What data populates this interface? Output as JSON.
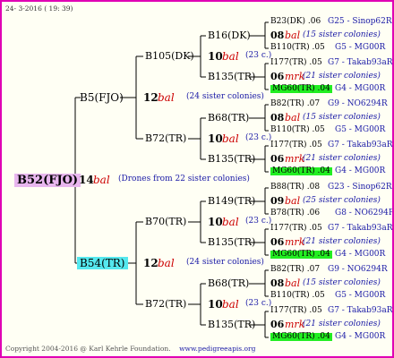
{
  "header": {
    "date": "24- 3-2016 ( 19: 39)"
  },
  "root": {
    "name": "B52(FJO)"
  },
  "root_link": {
    "gen": "14",
    "sym": "bal",
    "text": "(Drones from 22 sister colonies)"
  },
  "p1": {
    "name": "B5(FJO)"
  },
  "p2": {
    "name": "B54(TR)"
  },
  "p1_link": {
    "gen": "12",
    "sym": "bal",
    "text": "(24 sister colonies)"
  },
  "p2_link": {
    "gen": "12",
    "sym": "bal",
    "text": "(24 sister colonies)"
  },
  "g3": [
    {
      "name": "B105(DK)",
      "gen": "10",
      "sym": "bal",
      "text": "(23 c.)"
    },
    {
      "name": "B72(TR)",
      "gen": "10",
      "sym": "bal",
      "text": "(23 c.)"
    },
    {
      "name": "B70(TR)",
      "gen": "10",
      "sym": "bal",
      "text": "(23 c.)"
    },
    {
      "name": "B72(TR)",
      "gen": "10",
      "sym": "bal",
      "text": "(23 c.)"
    }
  ],
  "g4": [
    {
      "name": "B16(DK)"
    },
    {
      "name": "B135(TR)"
    },
    {
      "name": "B68(TR)"
    },
    {
      "name": "B135(TR)"
    },
    {
      "name": "B149(TR)"
    },
    {
      "name": "B135(TR)"
    },
    {
      "name": "B68(TR)"
    },
    {
      "name": "B135(TR)"
    }
  ],
  "g5": [
    {
      "top": "B23(DK) .06",
      "topR": "G25 - Sinop62R",
      "gen": "08",
      "sym": "bal",
      "text": "(15 sister colonies)",
      "bot": "B110(TR) .05",
      "botR": "G5 - MG00R",
      "botGreen": false
    },
    {
      "top": "I177(TR) .05",
      "topR": "G7 - Takab93aR",
      "gen": "06",
      "sym": "mrk",
      "text": "(21 sister colonies)",
      "bot": "MG60(TR) .04",
      "botR": "G4 - MG00R",
      "botGreen": true
    },
    {
      "top": "B82(TR) .07",
      "topR": "G9 - NO6294R",
      "gen": "08",
      "sym": "bal",
      "text": "(15 sister colonies)",
      "bot": "B110(TR) .05",
      "botR": "G5 - MG00R",
      "botGreen": false
    },
    {
      "top": "I177(TR) .05",
      "topR": "G7 - Takab93aR",
      "gen": "06",
      "sym": "mrk",
      "text": "(21 sister colonies)",
      "bot": "MG60(TR) .04",
      "botR": "G4 - MG00R",
      "botGreen": true
    },
    {
      "top": "B88(TR) .08",
      "topR": "G23 - Sinop62R",
      "gen": "09",
      "sym": "bal",
      "text": "(25 sister colonies)",
      "bot": "B78(TR) .06",
      "botR": "G8 - NO6294R",
      "botGreen": false
    },
    {
      "top": "I177(TR) .05",
      "topR": "G7 - Takab93aR",
      "gen": "06",
      "sym": "mrk",
      "text": "(21 sister colonies)",
      "bot": "MG60(TR) .04",
      "botR": "G4 - MG00R",
      "botGreen": true
    },
    {
      "top": "B82(TR) .07",
      "topR": "G9 - NO6294R",
      "gen": "08",
      "sym": "bal",
      "text": "(15 sister colonies)",
      "bot": "B110(TR) .05",
      "botR": "G5 - MG00R",
      "botGreen": false
    },
    {
      "top": "I177(TR) .05",
      "topR": "G7 - Takab93aR",
      "gen": "06",
      "sym": "mrk",
      "text": "(21 sister colonies)",
      "bot": "MG60(TR) .04",
      "botR": "G4 - MG00R",
      "botGreen": true
    }
  ],
  "footer": {
    "copyright": "Copyright 2004-2016 @ Karl Kehrle Foundation.",
    "site": "www.pedigreeapis.org"
  },
  "colors": {
    "border": "#e000b4",
    "root_bg": "#e8b6ee",
    "p2_bg": "#55e8ee",
    "green": "#22ee22",
    "link": "#1a1aa6",
    "sym": "#cc0000"
  }
}
